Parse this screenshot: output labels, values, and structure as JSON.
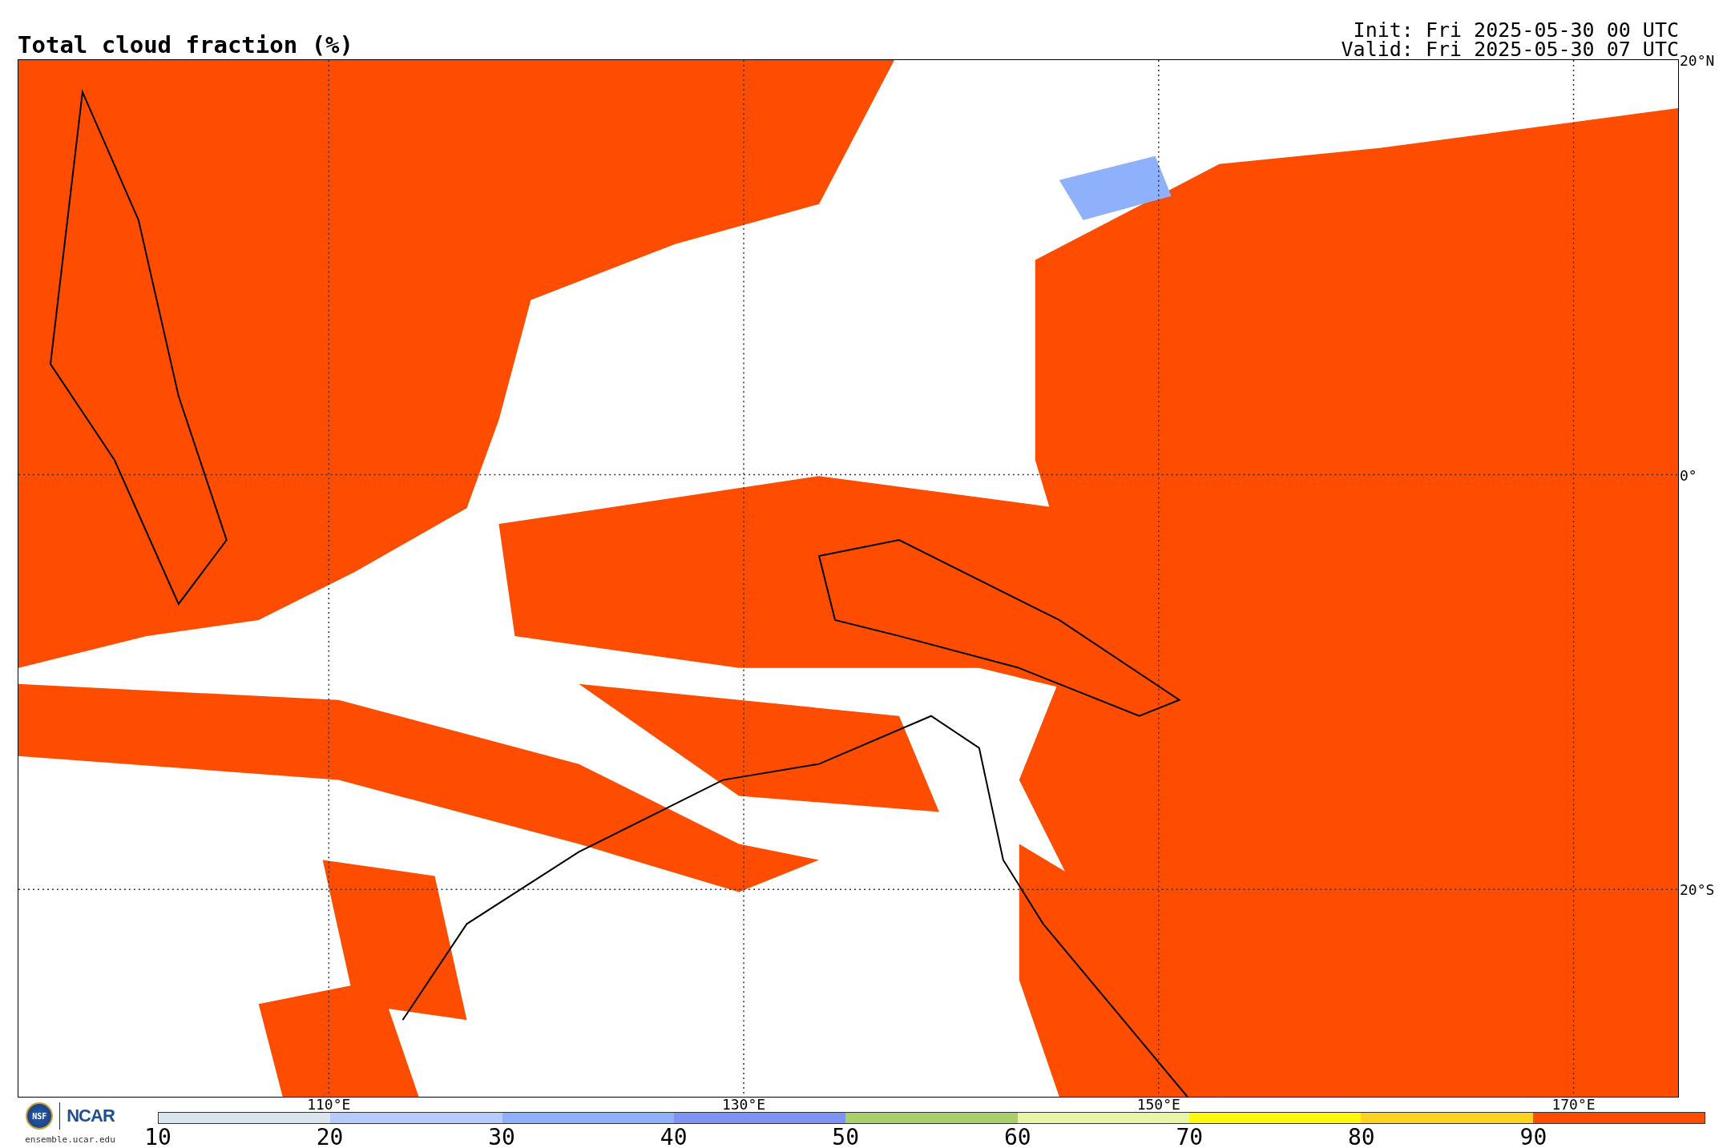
{
  "title": "Total cloud fraction (%)",
  "init": "Init: Fri 2025-05-30 00 UTC",
  "valid": "Valid: Fri 2025-05-30 07 UTC",
  "map": {
    "lat_labels": [
      "20°N",
      "0°",
      "20°S"
    ],
    "lon_labels": [
      "110°E",
      "130°E",
      "150°E",
      "170°E"
    ]
  },
  "colorbar": {
    "ticks": [
      "10",
      "20",
      "30",
      "40",
      "50",
      "60",
      "70",
      "80",
      "90"
    ],
    "segments": [
      {
        "color": "#d8e4ee"
      },
      {
        "color": "#b6cbf9"
      },
      {
        "color": "#8fb0fa"
      },
      {
        "color": "#7f93f7"
      },
      {
        "color": "#a8cf6a"
      },
      {
        "color": "#e8f5a6"
      },
      {
        "color": "#fdf810"
      },
      {
        "color": "#fdd221"
      },
      {
        "color": "#fe4d00"
      }
    ]
  },
  "footer": {
    "emblem": "NSF",
    "brand": "NCAR",
    "url": "ensemble.ucar.edu"
  }
}
